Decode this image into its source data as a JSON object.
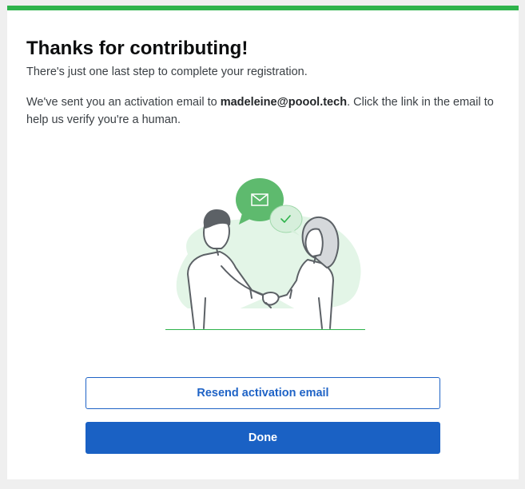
{
  "dialog": {
    "title": "Thanks for contributing!",
    "subtitle": "There's just one last step to complete your registration.",
    "message_prefix": "We've sent you an activation email to ",
    "email": "madeleine@poool.tech",
    "message_suffix": ". Click the link in the email to help us verify you're a human."
  },
  "illustration": {
    "icons": [
      "envelope-icon",
      "checkmark-icon"
    ],
    "accent_color": "#2eb34b"
  },
  "actions": {
    "resend_label": "Resend activation email",
    "done_label": "Done"
  },
  "colors": {
    "top_bar": "#2eb34b",
    "primary_button": "#1a61c4",
    "outline_button_text": "#1f63c6",
    "page_background": "#efefef"
  }
}
